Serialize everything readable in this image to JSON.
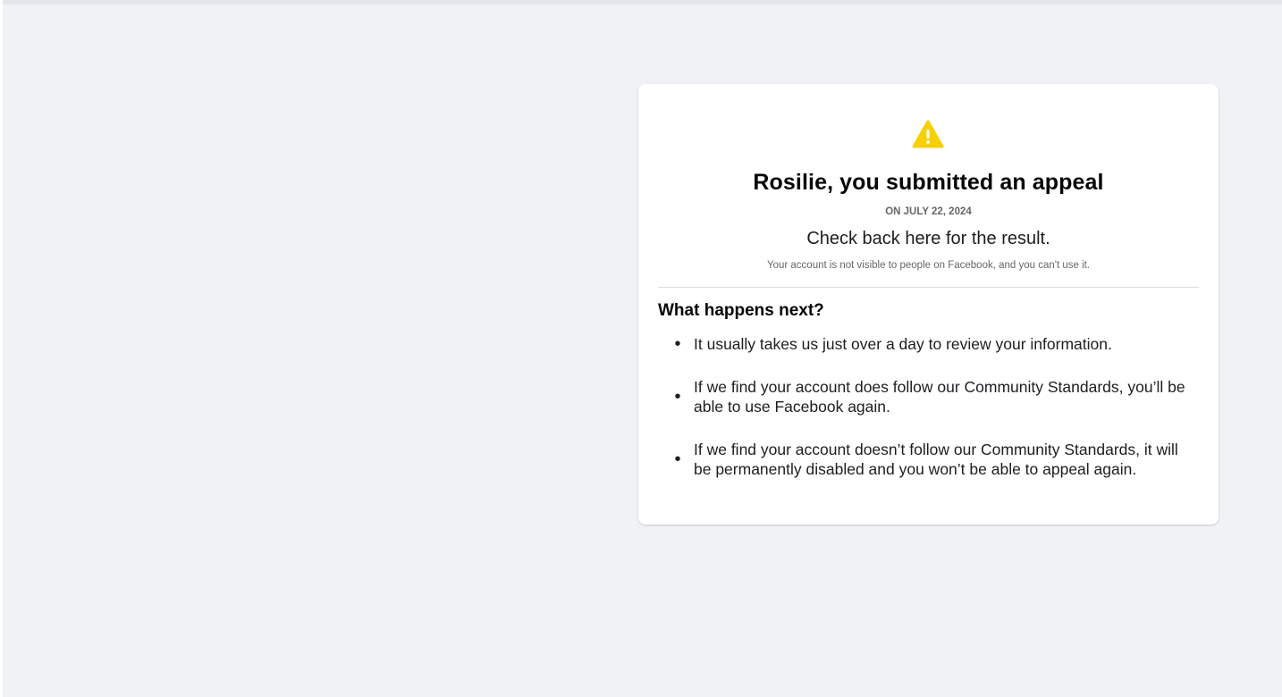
{
  "card": {
    "icon": "warning-triangle-icon",
    "title": "Rosilie, you submitted an appeal",
    "date": "ON JULY 22, 2024",
    "subtitle": "Check back here for the result.",
    "note": "Your account is not visible to people on Facebook, and you can't use it.",
    "next_heading": "What happens next?",
    "bullets": [
      "It usually takes us just over a day to review your information.",
      "If we find your account does follow our Community Standards, you’ll be able to use Facebook again.",
      "If we find your account doesn’t follow our Community Standards, it will be permanently disabled and you won’t be able to appeal again."
    ]
  },
  "colors": {
    "background": "#f0f2f5",
    "card": "#ffffff",
    "warning": "#f7d000",
    "text_primary": "#050505",
    "text_secondary": "#65676b"
  }
}
